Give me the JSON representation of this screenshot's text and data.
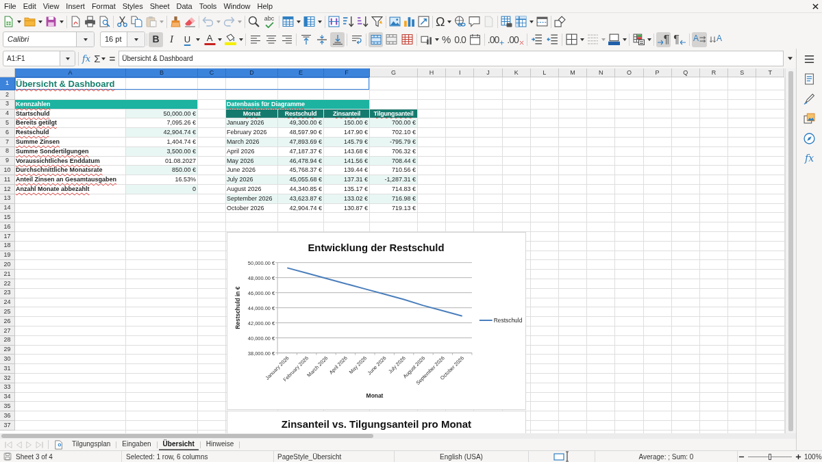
{
  "menu_bar": [
    "File",
    "Edit",
    "View",
    "Insert",
    "Format",
    "Styles",
    "Sheet",
    "Data",
    "Tools",
    "Window",
    "Help"
  ],
  "standard_toolbar": {
    "paste_disabled": true,
    "undo_disabled": true,
    "redo_disabled": true,
    "headers_footers_disabled": true,
    "spelling_label": "abc",
    "special_character_label": "Ω"
  },
  "formatting_toolbar": {
    "font_name": "Calibri",
    "font_size": "16 pt",
    "bold": {
      "label": "B",
      "on": true
    },
    "italic": {
      "label": "I",
      "on": false
    },
    "underline": {
      "label": "U",
      "on": false
    },
    "font_color_label": "A",
    "horizontal_align": [
      {
        "selected": false
      },
      {
        "selected": false
      },
      {
        "selected": false
      }
    ],
    "vertical_align": [
      {
        "selected": false
      },
      {
        "selected": false
      },
      {
        "selected": true
      }
    ],
    "wrap_text_on": false,
    "merge_and_center_on": true,
    "percent_label": "%",
    "standard_format_label": "0.0",
    "add_decimal_label": ".00",
    "delete_decimal_label": ".00",
    "border_style_disabled": true,
    "paragraph_direction": [
      {
        "label": "¶",
        "selected": true
      },
      {
        "label": "¶",
        "selected": false
      }
    ],
    "text_direction": [
      {
        "label": "A",
        "selected": true
      },
      {
        "label": "A",
        "selected": false
      }
    ]
  },
  "formula_bar": {
    "name_box": "A1:F1",
    "function_wizard_label": "fx",
    "sum_label": "Σ",
    "formula_label": "=",
    "content": "Übersicht & Dashboard"
  },
  "sidebar": {
    "functions_label": "fx"
  },
  "sheet": {
    "columns": [
      {
        "label": "A",
        "selected": true
      },
      {
        "label": "B",
        "selected": true
      },
      {
        "label": "C",
        "selected": true
      },
      {
        "label": "D",
        "selected": true
      },
      {
        "label": "E",
        "selected": true
      },
      {
        "label": "F",
        "selected": true
      },
      {
        "label": "G",
        "selected": false
      },
      {
        "label": "H",
        "selected": false
      },
      {
        "label": "I",
        "selected": false
      },
      {
        "label": "J",
        "selected": false
      },
      {
        "label": "K",
        "selected": false
      },
      {
        "label": "L",
        "selected": false
      },
      {
        "label": "M",
        "selected": false
      },
      {
        "label": "N",
        "selected": false
      },
      {
        "label": "O",
        "selected": false
      },
      {
        "label": "P",
        "selected": false
      },
      {
        "label": "Q",
        "selected": false
      },
      {
        "label": "R",
        "selected": false
      },
      {
        "label": "S",
        "selected": false
      },
      {
        "label": "T",
        "selected": false
      }
    ],
    "rows": [
      {
        "label": "1",
        "selected": true
      },
      {
        "label": "2",
        "selected": false
      },
      {
        "label": "3",
        "selected": false
      },
      {
        "label": "4",
        "selected": false
      },
      {
        "label": "5",
        "selected": false
      },
      {
        "label": "6",
        "selected": false
      },
      {
        "label": "7",
        "selected": false
      },
      {
        "label": "8",
        "selected": false
      },
      {
        "label": "9",
        "selected": false
      },
      {
        "label": "10",
        "selected": false
      },
      {
        "label": "11",
        "selected": false
      },
      {
        "label": "12",
        "selected": false
      },
      {
        "label": "13",
        "selected": false
      },
      {
        "label": "14",
        "selected": false
      },
      {
        "label": "15",
        "selected": false
      },
      {
        "label": "16",
        "selected": false
      },
      {
        "label": "17",
        "selected": false
      },
      {
        "label": "18",
        "selected": false
      },
      {
        "label": "19",
        "selected": false
      },
      {
        "label": "20",
        "selected": false
      },
      {
        "label": "21",
        "selected": false
      },
      {
        "label": "22",
        "selected": false
      },
      {
        "label": "23",
        "selected": false
      },
      {
        "label": "24",
        "selected": false
      },
      {
        "label": "25",
        "selected": false
      },
      {
        "label": "26",
        "selected": false
      },
      {
        "label": "27",
        "selected": false
      },
      {
        "label": "28",
        "selected": false
      },
      {
        "label": "29",
        "selected": false
      },
      {
        "label": "30",
        "selected": false
      },
      {
        "label": "31",
        "selected": false
      },
      {
        "label": "32",
        "selected": false
      },
      {
        "label": "33",
        "selected": false
      },
      {
        "label": "34",
        "selected": false
      },
      {
        "label": "35",
        "selected": false
      },
      {
        "label": "36",
        "selected": false
      },
      {
        "label": "37",
        "selected": false
      }
    ],
    "title": {
      "text": "Übersicht & Dashboard",
      "selected": true,
      "misspelled": true
    },
    "kpi_table": {
      "heading": {
        "text": "Kennzahlen",
        "misspelled": true
      },
      "items": [
        {
          "label": "Startschuld",
          "value": "50,000.00 €",
          "shaded": true,
          "misspelled": true
        },
        {
          "label": "Bereits getilgt",
          "value": "7,095.26 €",
          "shaded": false,
          "misspelled": true
        },
        {
          "label": "Restschuld",
          "value": "42,904.74 €",
          "shaded": true,
          "misspelled": true
        },
        {
          "label": "Summe Zinsen",
          "value": "1,404.74 €",
          "shaded": false,
          "misspelled": true
        },
        {
          "label": "Summe Sondertilgungen",
          "value": "3,500.00 €",
          "shaded": true,
          "misspelled": true
        },
        {
          "label": "Voraussichtliches Enddatum",
          "value": "01.08.2027",
          "shaded": false,
          "misspelled": true
        },
        {
          "label": "Durchschnittliche Monatsrate",
          "value": "850.00 €",
          "shaded": true,
          "misspelled": true
        },
        {
          "label": "Anteil Zinsen an Gesamtausgaben",
          "value": "16.53%",
          "shaded": false,
          "misspelled": true
        },
        {
          "label": "Anzahl Monate abbezahlt",
          "value": "0",
          "shaded": true,
          "misspelled": true
        }
      ]
    },
    "data_table": {
      "heading": {
        "text": "Datenbasis für Diagramme",
        "misspelled": true
      },
      "columns": [
        {
          "label": "Monat",
          "misspelled": true
        },
        {
          "label": "Restschuld",
          "misspelled": true
        },
        {
          "label": "Zinsanteil",
          "misspelled": true
        },
        {
          "label": "Tilgungsanteil",
          "misspelled": true
        }
      ],
      "rows": [
        {
          "cells": [
            "January 2026",
            "49,300.00 €",
            "150.00 €",
            "700.00 €"
          ],
          "shaded": true
        },
        {
          "cells": [
            "February 2026",
            "48,597.90 €",
            "147.90 €",
            "702.10 €"
          ],
          "shaded": false
        },
        {
          "cells": [
            "March 2026",
            "47,893.69 €",
            "145.79 €",
            "-795.79 €"
          ],
          "shaded": true
        },
        {
          "cells": [
            "April 2026",
            "47,187.37 €",
            "143.68 €",
            "706.32 €"
          ],
          "shaded": false
        },
        {
          "cells": [
            "May 2026",
            "46,478.94 €",
            "141.56 €",
            "708.44 €"
          ],
          "shaded": true
        },
        {
          "cells": [
            "June 2026",
            "45,768.37 €",
            "139.44 €",
            "710.56 €"
          ],
          "shaded": false
        },
        {
          "cells": [
            "July 2026",
            "45,055.68 €",
            "137.31 €",
            "-1,287.31 €"
          ],
          "shaded": true
        },
        {
          "cells": [
            "August 2026",
            "44,340.85 €",
            "135.17 €",
            "714.83 €"
          ],
          "shaded": false
        },
        {
          "cells": [
            "September 2026",
            "43,623.87 €",
            "133.02 €",
            "716.98 €"
          ],
          "shaded": true
        },
        {
          "cells": [
            "October 2026",
            "42,904.74 €",
            "130.87 €",
            "719.13 €"
          ],
          "shaded": false
        }
      ]
    }
  },
  "line_chart": {
    "chart_data": {
      "type": "line",
      "title": "Entwicklung der Restschuld",
      "xlabel": "Monat",
      "ylabel": "Restschuld in €",
      "categories": [
        "January 2026",
        "February 2026",
        "March 2026",
        "April 2026",
        "May 2026",
        "June 2026",
        "July 2026",
        "August 2026",
        "September 2026",
        "October 2026"
      ],
      "series": [
        {
          "name": "Restschuld",
          "color": "#4a7ebb",
          "values": [
            49300,
            48600,
            47900,
            47200,
            46500,
            45800,
            45100,
            44300,
            43600,
            42900
          ]
        }
      ],
      "ylim": [
        38000,
        50000
      ],
      "yticks": [
        {
          "value": 38000,
          "label": "38,000.00 €"
        },
        {
          "value": 40000,
          "label": "40,000.00 €"
        },
        {
          "value": 42000,
          "label": "42,000.00 €"
        },
        {
          "value": 44000,
          "label": "44,000.00 €"
        },
        {
          "value": 46000,
          "label": "46,000.00 €"
        },
        {
          "value": 48000,
          "label": "48,000.00 €"
        },
        {
          "value": 50000,
          "label": "50,000.00 €"
        }
      ],
      "grid": true
    }
  },
  "second_chart": {
    "title": "Zinsanteil vs. Tilgungsanteil pro Monat"
  },
  "sheet_tab_bar": {
    "navigation_disabled": true,
    "tabs": [
      {
        "label": "Tilgungsplan",
        "selected": false
      },
      {
        "label": "Eingaben",
        "selected": false
      },
      {
        "label": "Übersicht",
        "selected": true
      },
      {
        "label": "Hinweise",
        "selected": false
      }
    ]
  },
  "status_bar": {
    "sheet_position": "Sheet 3 of 4",
    "selection": "Selected: 1 row, 6 columns",
    "page_style": "PageStyle_Übersicht",
    "language": "English (USA)",
    "statistics": "Average: ; Sum: 0",
    "zoom_slider": {
      "level": 0.5
    },
    "zoom": "100%"
  }
}
